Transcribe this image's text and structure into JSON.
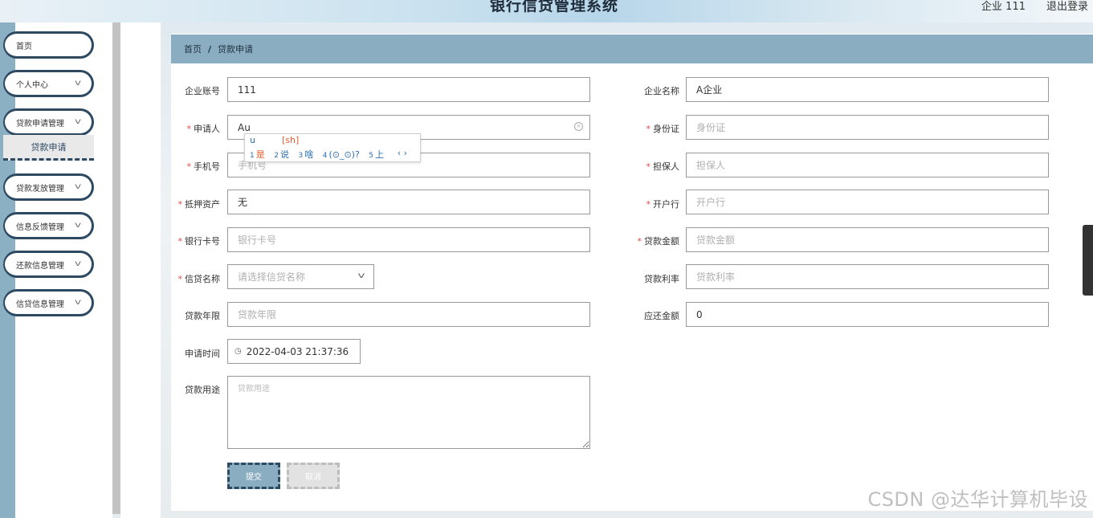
{
  "header": {
    "title": "银行信贷管理系统",
    "user": "企业 111",
    "logout": "退出登录"
  },
  "sidebar": {
    "items": [
      {
        "label": "首页"
      },
      {
        "label": "个人中心"
      },
      {
        "label": "贷款申请管理"
      },
      {
        "label": "贷款发放管理"
      },
      {
        "label": "信息反馈管理"
      },
      {
        "label": "还款信息管理"
      },
      {
        "label": "信贷信息管理"
      }
    ],
    "submenu": {
      "label": "贷款申请"
    }
  },
  "breadcrumb": {
    "home": "首页",
    "separator": "/",
    "current": "贷款申请"
  },
  "form": {
    "company_account": {
      "label": "企业账号",
      "value": "111"
    },
    "company_name": {
      "label": "企业名称",
      "value": "A企业"
    },
    "applicant": {
      "label": "申请人",
      "value": "Au"
    },
    "id_card": {
      "label": "身份证",
      "placeholder": "身份证"
    },
    "phone": {
      "label": "手机号",
      "placeholder": "手机号"
    },
    "guarantor": {
      "label": "担保人",
      "placeholder": "担保人"
    },
    "collateral": {
      "label": "抵押资产",
      "value": "无"
    },
    "bank": {
      "label": "开户行",
      "placeholder": "开户行"
    },
    "card_no": {
      "label": "银行卡号",
      "placeholder": "银行卡号"
    },
    "amount": {
      "label": "贷款金额",
      "placeholder": "贷款金额"
    },
    "credit_name": {
      "label": "信贷名称",
      "placeholder": "请选择信贷名称"
    },
    "rate": {
      "label": "贷款利率",
      "placeholder": "贷款利率"
    },
    "term": {
      "label": "贷款年限",
      "placeholder": "贷款年限"
    },
    "payable": {
      "label": "应还金额",
      "value": "0"
    },
    "apply_time": {
      "label": "申请时间",
      "value": "2022-04-03 21:37:36"
    },
    "purpose": {
      "label": "贷款用途",
      "placeholder": "贷款用途"
    },
    "submit": "提交",
    "cancel": "取消"
  },
  "ime": {
    "composition": "u",
    "pinyin": "[sh]",
    "candidates": [
      {
        "n": "1",
        "text": "是"
      },
      {
        "n": "2",
        "text": "说"
      },
      {
        "n": "3",
        "text": "啥"
      },
      {
        "n": "4",
        "text": "(⊙_⊙)?"
      },
      {
        "n": "5",
        "text": "上"
      }
    ],
    "nav": "‹ ›"
  },
  "watermark": "CSDN @达华计算机毕设"
}
